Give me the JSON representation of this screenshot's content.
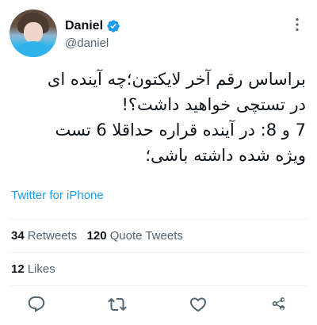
{
  "author": {
    "display_name": "Daniel",
    "handle": "@daniel",
    "verified_icon": "verified-badge-icon",
    "avatar": "avatar"
  },
  "tweet": {
    "lines": [
      "براساس رقم آخر لایکتون؛چه آینده ای",
      "در تستچی خواهید داشت؟!",
      "7 و 8: در آینده قراره حداقلا 6 تست",
      "ویژه شده داشته باشی؛"
    ],
    "source": "Twitter for iPhone"
  },
  "stats": {
    "retweets_count": "34",
    "retweets_label": "Retweets",
    "quotes_count": "120",
    "quotes_label": "Quote Tweets",
    "likes_count": "12",
    "likes_label": "Likes"
  },
  "actions": [
    "reply-icon",
    "retweet-icon",
    "like-icon",
    "share-icon"
  ],
  "colors": {
    "accent": "#1d9bf0",
    "text": "#0f1419",
    "secondary": "#536471",
    "divider": "#eff3f4"
  }
}
